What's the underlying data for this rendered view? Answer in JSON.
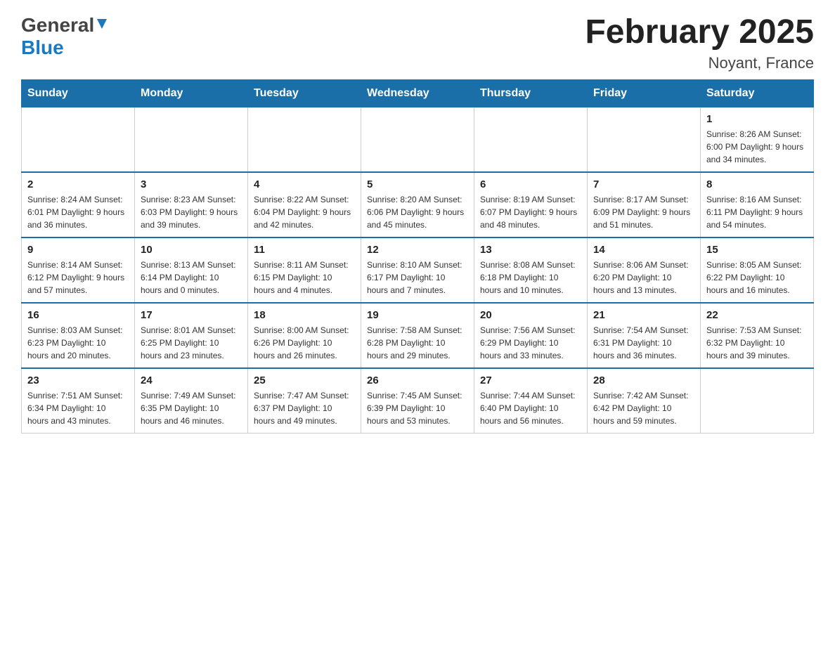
{
  "header": {
    "logo_general": "General",
    "logo_blue": "Blue",
    "title": "February 2025",
    "location": "Noyant, France"
  },
  "weekdays": [
    "Sunday",
    "Monday",
    "Tuesday",
    "Wednesday",
    "Thursday",
    "Friday",
    "Saturday"
  ],
  "weeks": [
    [
      {
        "day": "",
        "info": ""
      },
      {
        "day": "",
        "info": ""
      },
      {
        "day": "",
        "info": ""
      },
      {
        "day": "",
        "info": ""
      },
      {
        "day": "",
        "info": ""
      },
      {
        "day": "",
        "info": ""
      },
      {
        "day": "1",
        "info": "Sunrise: 8:26 AM\nSunset: 6:00 PM\nDaylight: 9 hours and 34 minutes."
      }
    ],
    [
      {
        "day": "2",
        "info": "Sunrise: 8:24 AM\nSunset: 6:01 PM\nDaylight: 9 hours and 36 minutes."
      },
      {
        "day": "3",
        "info": "Sunrise: 8:23 AM\nSunset: 6:03 PM\nDaylight: 9 hours and 39 minutes."
      },
      {
        "day": "4",
        "info": "Sunrise: 8:22 AM\nSunset: 6:04 PM\nDaylight: 9 hours and 42 minutes."
      },
      {
        "day": "5",
        "info": "Sunrise: 8:20 AM\nSunset: 6:06 PM\nDaylight: 9 hours and 45 minutes."
      },
      {
        "day": "6",
        "info": "Sunrise: 8:19 AM\nSunset: 6:07 PM\nDaylight: 9 hours and 48 minutes."
      },
      {
        "day": "7",
        "info": "Sunrise: 8:17 AM\nSunset: 6:09 PM\nDaylight: 9 hours and 51 minutes."
      },
      {
        "day": "8",
        "info": "Sunrise: 8:16 AM\nSunset: 6:11 PM\nDaylight: 9 hours and 54 minutes."
      }
    ],
    [
      {
        "day": "9",
        "info": "Sunrise: 8:14 AM\nSunset: 6:12 PM\nDaylight: 9 hours and 57 minutes."
      },
      {
        "day": "10",
        "info": "Sunrise: 8:13 AM\nSunset: 6:14 PM\nDaylight: 10 hours and 0 minutes."
      },
      {
        "day": "11",
        "info": "Sunrise: 8:11 AM\nSunset: 6:15 PM\nDaylight: 10 hours and 4 minutes."
      },
      {
        "day": "12",
        "info": "Sunrise: 8:10 AM\nSunset: 6:17 PM\nDaylight: 10 hours and 7 minutes."
      },
      {
        "day": "13",
        "info": "Sunrise: 8:08 AM\nSunset: 6:18 PM\nDaylight: 10 hours and 10 minutes."
      },
      {
        "day": "14",
        "info": "Sunrise: 8:06 AM\nSunset: 6:20 PM\nDaylight: 10 hours and 13 minutes."
      },
      {
        "day": "15",
        "info": "Sunrise: 8:05 AM\nSunset: 6:22 PM\nDaylight: 10 hours and 16 minutes."
      }
    ],
    [
      {
        "day": "16",
        "info": "Sunrise: 8:03 AM\nSunset: 6:23 PM\nDaylight: 10 hours and 20 minutes."
      },
      {
        "day": "17",
        "info": "Sunrise: 8:01 AM\nSunset: 6:25 PM\nDaylight: 10 hours and 23 minutes."
      },
      {
        "day": "18",
        "info": "Sunrise: 8:00 AM\nSunset: 6:26 PM\nDaylight: 10 hours and 26 minutes."
      },
      {
        "day": "19",
        "info": "Sunrise: 7:58 AM\nSunset: 6:28 PM\nDaylight: 10 hours and 29 minutes."
      },
      {
        "day": "20",
        "info": "Sunrise: 7:56 AM\nSunset: 6:29 PM\nDaylight: 10 hours and 33 minutes."
      },
      {
        "day": "21",
        "info": "Sunrise: 7:54 AM\nSunset: 6:31 PM\nDaylight: 10 hours and 36 minutes."
      },
      {
        "day": "22",
        "info": "Sunrise: 7:53 AM\nSunset: 6:32 PM\nDaylight: 10 hours and 39 minutes."
      }
    ],
    [
      {
        "day": "23",
        "info": "Sunrise: 7:51 AM\nSunset: 6:34 PM\nDaylight: 10 hours and 43 minutes."
      },
      {
        "day": "24",
        "info": "Sunrise: 7:49 AM\nSunset: 6:35 PM\nDaylight: 10 hours and 46 minutes."
      },
      {
        "day": "25",
        "info": "Sunrise: 7:47 AM\nSunset: 6:37 PM\nDaylight: 10 hours and 49 minutes."
      },
      {
        "day": "26",
        "info": "Sunrise: 7:45 AM\nSunset: 6:39 PM\nDaylight: 10 hours and 53 minutes."
      },
      {
        "day": "27",
        "info": "Sunrise: 7:44 AM\nSunset: 6:40 PM\nDaylight: 10 hours and 56 minutes."
      },
      {
        "day": "28",
        "info": "Sunrise: 7:42 AM\nSunset: 6:42 PM\nDaylight: 10 hours and 59 minutes."
      },
      {
        "day": "",
        "info": ""
      }
    ]
  ]
}
